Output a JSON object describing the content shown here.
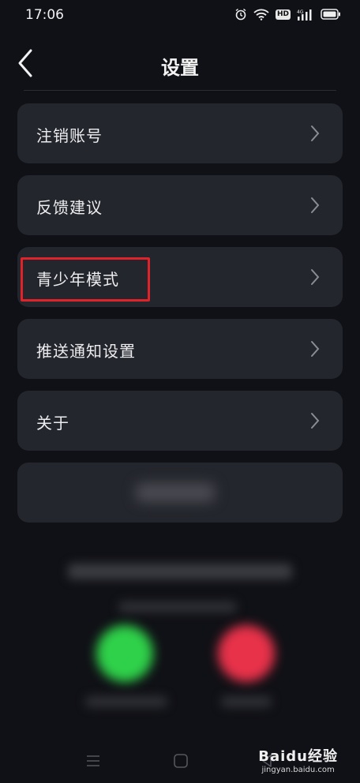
{
  "status_bar": {
    "time": "17:06",
    "network": "4G",
    "hd": "HD"
  },
  "header": {
    "title": "设置"
  },
  "settings": [
    {
      "label": "注销账号",
      "icon": "chevron-right-icon"
    },
    {
      "label": "反馈建议",
      "icon": "chevron-right-icon"
    },
    {
      "label": "青少年模式",
      "icon": "chevron-right-icon",
      "highlighted": true
    },
    {
      "label": "推送通知设置",
      "icon": "chevron-right-icon"
    },
    {
      "label": "关于",
      "icon": "chevron-right-icon"
    }
  ],
  "colors": {
    "background": "#101116",
    "card": "#24262d",
    "highlight": "#e0232b",
    "accept": "#2fd14a",
    "decline": "#e8324a"
  },
  "watermark": {
    "brand": "Baidu经验",
    "url": "jingyan.baidu.com"
  }
}
